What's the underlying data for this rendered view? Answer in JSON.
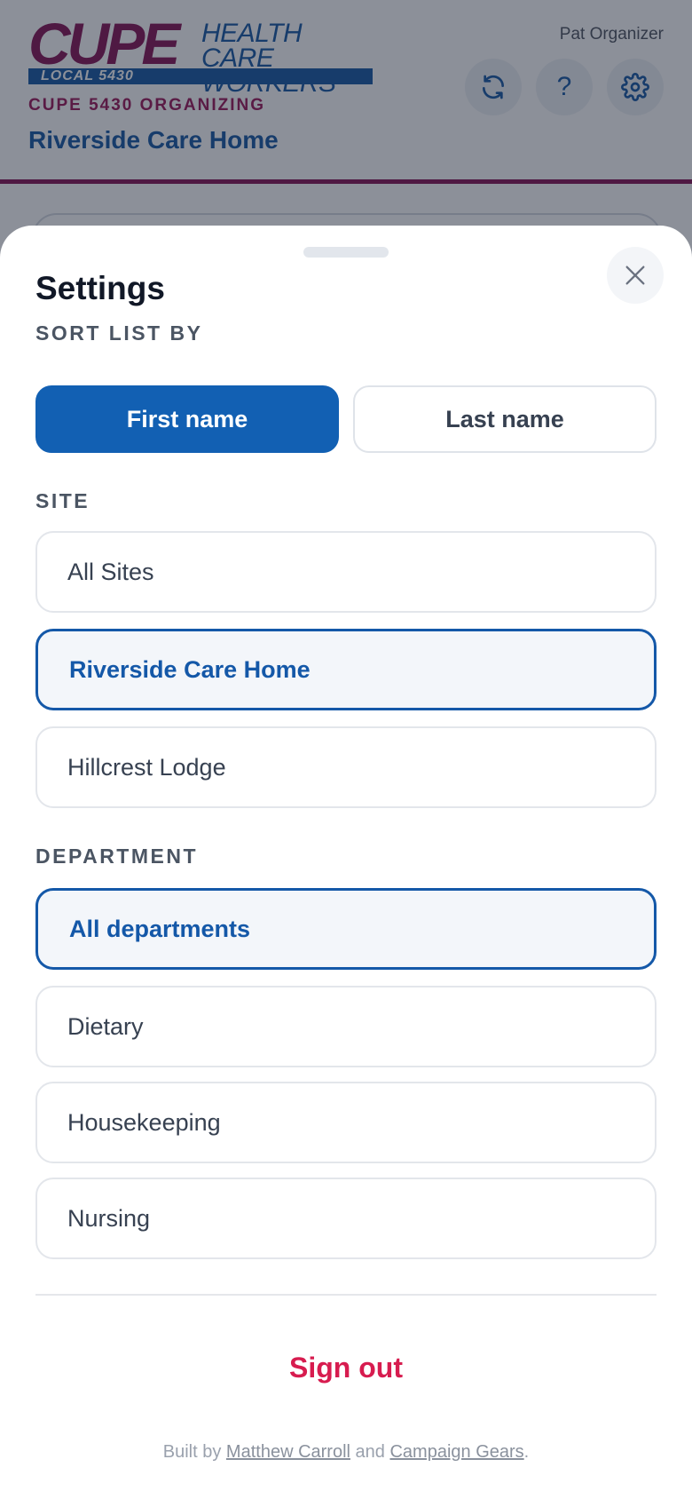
{
  "header": {
    "logo": {
      "cupe": "CUPE",
      "line1": "HEALTH CARE",
      "line2": "WORKERS",
      "local": "LOCAL 5430"
    },
    "org_label": "CUPE 5430 ORGANIZING",
    "site_title": "Riverside Care Home",
    "user_name": "Pat Organizer",
    "icons": {
      "refresh": "refresh-icon",
      "help": "help-icon",
      "settings": "gear-icon"
    },
    "help_glyph": "?"
  },
  "sheet": {
    "title": "Settings",
    "close_icon": "close-icon",
    "sort": {
      "label": "SORT LIST BY",
      "options": [
        {
          "label": "First name",
          "selected": true
        },
        {
          "label": "Last name",
          "selected": false
        }
      ]
    },
    "site": {
      "label": "SITE",
      "options": [
        {
          "label": "All Sites",
          "selected": false
        },
        {
          "label": "Riverside Care Home",
          "selected": true
        },
        {
          "label": "Hillcrest Lodge",
          "selected": false
        }
      ]
    },
    "department": {
      "label": "DEPARTMENT",
      "options": [
        {
          "label": "All departments",
          "selected": true
        },
        {
          "label": "Dietary",
          "selected": false
        },
        {
          "label": "Housekeeping",
          "selected": false
        },
        {
          "label": "Nursing",
          "selected": false
        }
      ]
    },
    "sign_out": "Sign out",
    "footer": {
      "prefix": "Built by",
      "author": "Matthew Carroll",
      "and": "and",
      "company": "Campaign Gears",
      "suffix": "."
    }
  },
  "colors": {
    "brand_blue": "#1260b3",
    "brand_magenta": "#8a1c5b",
    "danger": "#d71c4f"
  }
}
